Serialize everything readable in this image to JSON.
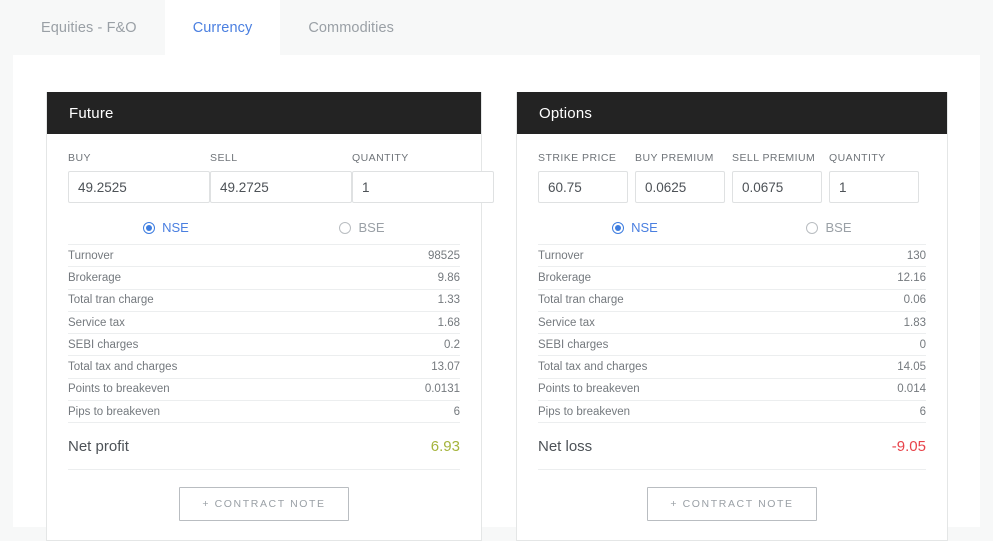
{
  "tabs": [
    {
      "label": "Equities - F&O",
      "active": false
    },
    {
      "label": "Currency",
      "active": true
    },
    {
      "label": "Commodities",
      "active": false
    }
  ],
  "colors": {
    "accent": "#4a7fe0",
    "header_bg": "#232323",
    "profit": "#a5b43c",
    "loss": "#e8434a",
    "muted_text": "#9aa0a6"
  },
  "cards": [
    {
      "title": "Future",
      "fields": [
        {
          "label": "BUY",
          "value": "49.2525",
          "placeholder": ""
        },
        {
          "label": "SELL",
          "value": "49.2725",
          "placeholder": ""
        },
        {
          "label": "QUANTITY",
          "value": "1",
          "placeholder": ""
        }
      ],
      "exchanges": [
        {
          "label": "NSE",
          "selected": true
        },
        {
          "label": "BSE",
          "selected": false
        }
      ],
      "rows": [
        {
          "label": "Turnover",
          "value": "98525"
        },
        {
          "label": "Brokerage",
          "value": "9.86"
        },
        {
          "label": "Total tran charge",
          "value": "1.33"
        },
        {
          "label": "Service tax",
          "value": "1.68"
        },
        {
          "label": "SEBI charges",
          "value": "0.2"
        },
        {
          "label": "Total tax and charges",
          "value": "13.07"
        },
        {
          "label": "Points to breakeven",
          "value": "0.0131"
        },
        {
          "label": "Pips to breakeven",
          "value": "6"
        }
      ],
      "total": {
        "label": "Net profit",
        "value": "6.93",
        "color": "#a5b43c"
      },
      "footer_button": "+ CONTRACT NOTE"
    },
    {
      "title": "Options",
      "fields": [
        {
          "label": "STRIKE PRICE",
          "value": "60.75",
          "placeholder": ""
        },
        {
          "label": "BUY PREMIUM",
          "value": "0.0625",
          "placeholder": ""
        },
        {
          "label": "SELL PREMIUM",
          "value": "0.0675",
          "placeholder": ""
        },
        {
          "label": "QUANTITY",
          "value": "1",
          "placeholder": ""
        }
      ],
      "exchanges": [
        {
          "label": "NSE",
          "selected": true
        },
        {
          "label": "BSE",
          "selected": false
        }
      ],
      "rows": [
        {
          "label": "Turnover",
          "value": "130"
        },
        {
          "label": "Brokerage",
          "value": "12.16"
        },
        {
          "label": "Total tran charge",
          "value": "0.06"
        },
        {
          "label": "Service tax",
          "value": "1.83"
        },
        {
          "label": "SEBI charges",
          "value": "0"
        },
        {
          "label": "Total tax and charges",
          "value": "14.05"
        },
        {
          "label": "Points to breakeven",
          "value": "0.014"
        },
        {
          "label": "Pips to breakeven",
          "value": "6"
        }
      ],
      "total": {
        "label": "Net loss",
        "value": "-9.05",
        "color": "#e8434a"
      },
      "footer_button": "+ CONTRACT NOTE"
    }
  ]
}
